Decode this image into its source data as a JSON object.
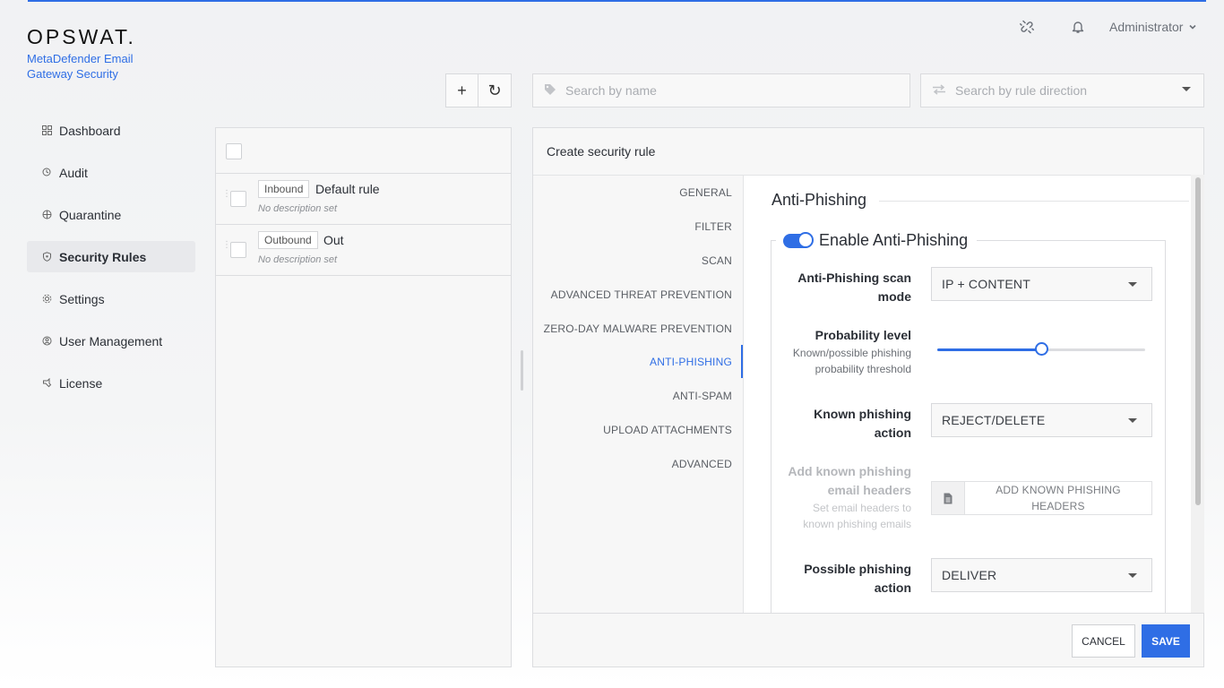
{
  "brand": {
    "logo": "OPSWAT.",
    "product_line1": "MetaDefender Email",
    "product_line2": "Gateway Security"
  },
  "header": {
    "user": "Administrator",
    "icons": [
      "unlink-icon",
      "bell-icon",
      "chevron-down-icon"
    ]
  },
  "sidebar": {
    "items": [
      {
        "label": "Dashboard",
        "icon": "grid-icon",
        "active": false
      },
      {
        "label": "Audit",
        "icon": "audit-icon",
        "active": false
      },
      {
        "label": "Quarantine",
        "icon": "quarantine-icon",
        "active": false
      },
      {
        "label": "Security Rules",
        "icon": "shield-icon",
        "active": true
      },
      {
        "label": "Settings",
        "icon": "gear-icon",
        "active": false
      },
      {
        "label": "User Management",
        "icon": "users-icon",
        "active": false
      },
      {
        "label": "License",
        "icon": "license-icon",
        "active": false
      }
    ]
  },
  "toolbar": {
    "add_glyph": "+",
    "refresh_glyph": "↻",
    "search_name_placeholder": "Search by name",
    "search_direction_placeholder": "Search by rule direction"
  },
  "rules": [
    {
      "direction": "Inbound",
      "name": "Default rule",
      "description": "No description set"
    },
    {
      "direction": "Outbound",
      "name": "Out",
      "description": "No description set"
    }
  ],
  "panel": {
    "title": "Create security rule",
    "sections": [
      {
        "label": "GENERAL",
        "active": false
      },
      {
        "label": "FILTER",
        "active": false
      },
      {
        "label": "SCAN",
        "active": false
      },
      {
        "label": "ADVANCED THREAT PREVENTION",
        "active": false
      },
      {
        "label": "ZERO-DAY MALWARE PREVENTION",
        "active": false
      },
      {
        "label": "ANTI-PHISHING",
        "active": true
      },
      {
        "label": "ANTI-SPAM",
        "active": false
      },
      {
        "label": "UPLOAD ATTACHMENTS",
        "active": false
      },
      {
        "label": "ADVANCED",
        "active": false
      }
    ],
    "content": {
      "heading": "Anti-Phishing",
      "enable_label": "Enable Anti-Phishing",
      "enabled": true,
      "scan_mode": {
        "label_line1": "Anti-Phishing scan",
        "label_line2": "mode",
        "value": "IP + CONTENT"
      },
      "probability": {
        "label": "Probability level",
        "sub_line1": "Known/possible phishing",
        "sub_line2": "probability threshold",
        "value_fraction": 0.5
      },
      "known_action": {
        "label_line1": "Known phishing",
        "label_line2": "action",
        "value": "REJECT/DELETE"
      },
      "headers": {
        "label_line1": "Add known phishing",
        "label_line2": "email headers",
        "sub_line1": "Set email headers to",
        "sub_line2": "known phishing emails",
        "button_line1": "ADD KNOWN PHISHING",
        "button_line2": "HEADERS"
      },
      "possible_action": {
        "label_line1": "Possible phishing",
        "label_line2": "action",
        "value": "DELIVER"
      }
    },
    "cancel_label": "CANCEL",
    "save_label": "SAVE"
  },
  "colors": {
    "accent": "#2f6ee5"
  }
}
